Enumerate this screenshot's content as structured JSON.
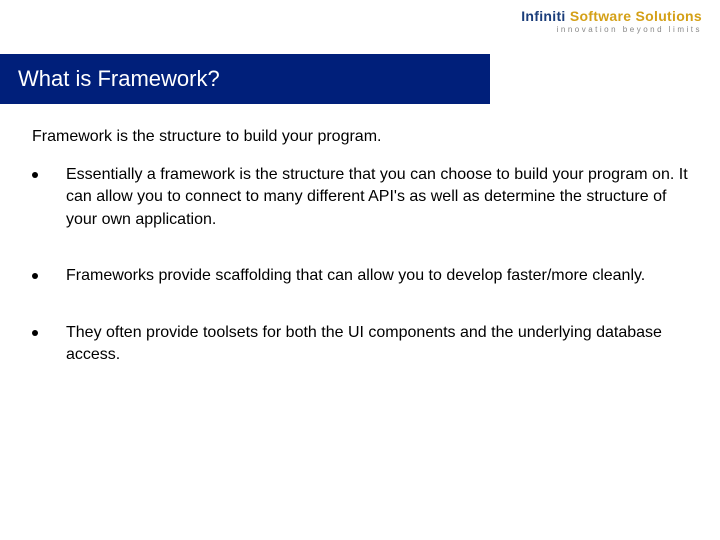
{
  "logo": {
    "brand_first": "Infiniti ",
    "brand_second": "Software Solutions",
    "tagline": "innovation beyond limits"
  },
  "title": "What is Framework?",
  "intro": "Framework is the structure to build your program.",
  "bullets": [
    "Essentially a framework is the structure that you can choose to build your program on. It can allow you to connect to many different API's as well as determine the structure of your own application.",
    " Frameworks provide scaffolding that can allow you to develop faster/more cleanly.",
    "They often provide toolsets for both the UI components and the underlying database access."
  ]
}
